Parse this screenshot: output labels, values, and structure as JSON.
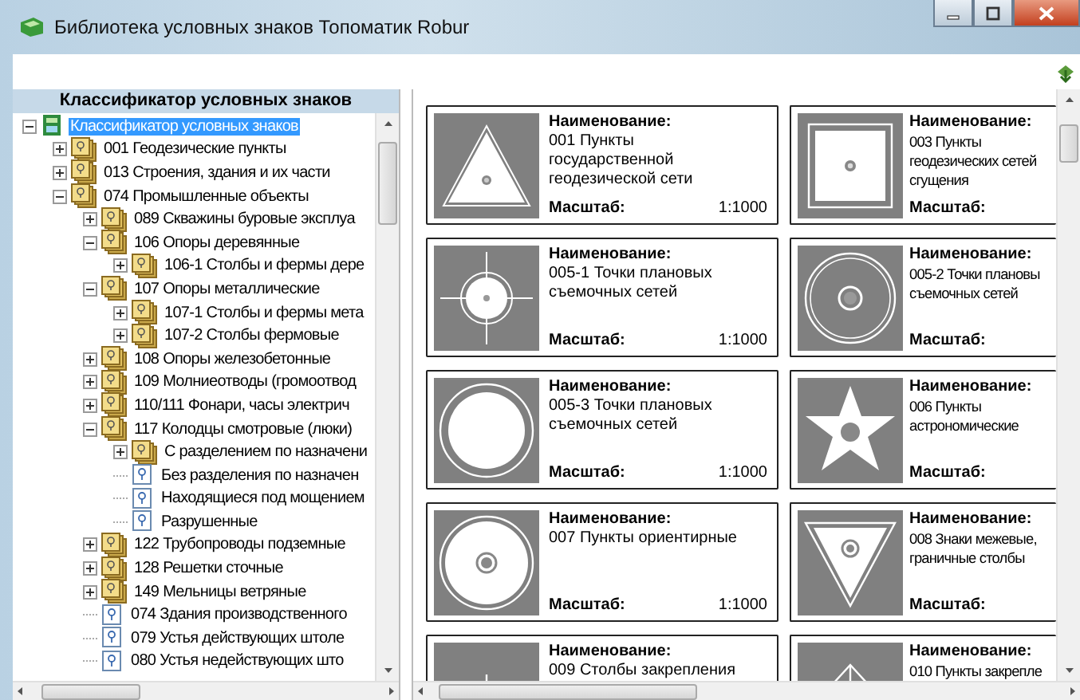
{
  "window": {
    "title": "Библиотека условных знаков Топоматик Robur"
  },
  "classifier": {
    "header": "Классификатор условных знаков",
    "tree": [
      {
        "label": "Классификатор условных знаков",
        "kind": "root",
        "expanded": true,
        "selected": true,
        "children": [
          {
            "label": "001 Геодезические пункты",
            "kind": "folder",
            "expanded": false,
            "selected": false
          },
          {
            "label": "013 Строения, здания и их части",
            "kind": "folder",
            "expanded": false,
            "selected": false
          },
          {
            "label": "074 Промышленные объекты",
            "kind": "folder",
            "expanded": true,
            "selected": false,
            "children": [
              {
                "label": "089 Скважины буровые эксплуа",
                "kind": "folder",
                "expanded": false,
                "selected": false
              },
              {
                "label": "106 Опоры деревянные",
                "kind": "folder",
                "expanded": true,
                "selected": false,
                "children": [
                  {
                    "label": "106-1 Столбы и фермы дере",
                    "kind": "folder",
                    "expanded": false,
                    "selected": false
                  }
                ]
              },
              {
                "label": "107 Опоры металлические",
                "kind": "folder",
                "expanded": true,
                "selected": false,
                "children": [
                  {
                    "label": "107-1 Столбы и фермы мета",
                    "kind": "folder",
                    "expanded": false,
                    "selected": false
                  },
                  {
                    "label": "107-2 Столбы фермовые",
                    "kind": "folder",
                    "expanded": false,
                    "selected": false
                  }
                ]
              },
              {
                "label": "108 Опоры железобетонные",
                "kind": "folder",
                "expanded": false,
                "selected": false
              },
              {
                "label": "109 Молниеотводы (громоотвод",
                "kind": "folder",
                "expanded": false,
                "selected": false
              },
              {
                "label": "110/111 Фонари, часы электрич",
                "kind": "folder",
                "expanded": false,
                "selected": false
              },
              {
                "label": "117 Колодцы смотровые (люки)",
                "kind": "folder",
                "expanded": true,
                "selected": false,
                "children": [
                  {
                    "label": "С разделением по назначени",
                    "kind": "folder",
                    "expanded": false,
                    "selected": false
                  },
                  {
                    "label": "Без разделения по назначен",
                    "kind": "leaf",
                    "selected": false
                  },
                  {
                    "label": "Находящиеся под мощением",
                    "kind": "leaf",
                    "selected": false
                  },
                  {
                    "label": "Разрушенные",
                    "kind": "leaf",
                    "selected": false
                  }
                ]
              },
              {
                "label": "122 Трубопроводы подземные",
                "kind": "folder",
                "expanded": false,
                "selected": false
              },
              {
                "label": "128 Решетки сточные",
                "kind": "folder",
                "expanded": false,
                "selected": false
              },
              {
                "label": "149 Мельницы ветряные",
                "kind": "folder",
                "expanded": false,
                "selected": false
              },
              {
                "label": "074 Здания производственного",
                "kind": "leaf",
                "selected": false
              },
              {
                "label": "079 Устья действующих штоле",
                "kind": "leaf",
                "selected": false
              },
              {
                "label": "080 Устья недействующих што",
                "kind": "leaf",
                "selected": false
              }
            ]
          }
        ]
      }
    ]
  },
  "cards": [
    {
      "kind": "triangle",
      "name_label": "Наименование:",
      "name": "001 Пункты государственной геодезической сети",
      "scale_label": "Масштаб:",
      "scale": "1:1000"
    },
    {
      "kind": "square",
      "name_label": "Наименование:",
      "name": "003 Пункты\nгеодезических сетей\nсгущения",
      "scale_label": "Масштаб:"
    },
    {
      "kind": "crosshair",
      "name_label": "Наименование:",
      "name": "005-1 Точки плановых съемочных сетей",
      "scale_label": "Масштаб:",
      "scale": "1:1000"
    },
    {
      "kind": "ring",
      "name_label": "Наименование:",
      "name": "005-2 Точки плановы\nсъемочных сетей",
      "scale_label": "Масштаб:"
    },
    {
      "kind": "circle",
      "name_label": "Наименование:",
      "name": "005-3 Точки плановых съемочных сетей",
      "scale_label": "Масштаб:",
      "scale": "1:1000"
    },
    {
      "kind": "star",
      "name_label": "Наименование:",
      "name": "006 Пункты\nастрономические",
      "scale_label": "Масштаб:"
    },
    {
      "kind": "target",
      "name_label": "Наименование:",
      "name": "007 Пункты ориентирные",
      "scale_label": "Масштаб:",
      "scale": "1:1000"
    },
    {
      "kind": "inverted",
      "name_label": "Наименование:",
      "name": "008 Знаки межевые,\nграничные столбы",
      "scale_label": "Масштаб:"
    },
    {
      "kind": "pole",
      "name_label": "Наименование:",
      "name": "009 Столбы закрепления"
    },
    {
      "kind": "arrow",
      "name_label": "Наименование:",
      "name": "010 Пункты закрепле"
    }
  ]
}
